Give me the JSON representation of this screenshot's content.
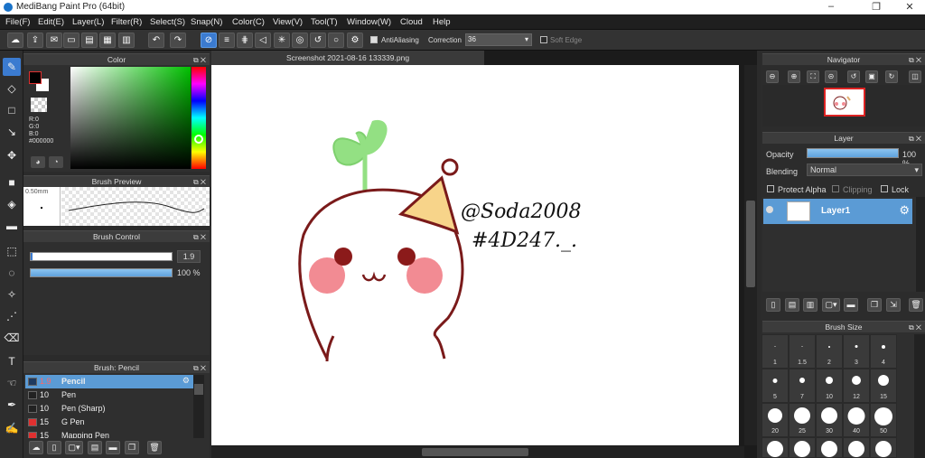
{
  "window": {
    "title": "MediBang Paint Pro (64bit)",
    "minimize": "–",
    "maximize": "❐",
    "close": "✕"
  },
  "menu": [
    "File(F)",
    "Edit(E)",
    "Layer(L)",
    "Filter(R)",
    "Select(S)",
    "Snap(N)",
    "Color(C)",
    "View(V)",
    "Tool(T)",
    "Window(W)",
    "Cloud",
    "Help"
  ],
  "toolbar": {
    "antialiasing_label": "AntiAliasing",
    "correction_label": "Correction",
    "correction_value": "36",
    "soft_edge_label": "Soft Edge"
  },
  "color_panel": {
    "title": "Color",
    "r": "R:0",
    "g": "G:0",
    "b": "B:0",
    "hex": "#000000",
    "primary_color": "#000000",
    "secondary_color": "#ffffff"
  },
  "brush_preview": {
    "title": "Brush Preview",
    "size": "0.50mm"
  },
  "brush_control": {
    "title": "Brush Control",
    "size_value": "1.9",
    "opacity_value": "100 %"
  },
  "brush_list": {
    "title": "Brush: Pencil",
    "items": [
      {
        "size": "1.9",
        "name": "Pencil",
        "color": "#1e3a5f",
        "selected": true
      },
      {
        "size": "10",
        "name": "Pen",
        "color": "#222222",
        "selected": false
      },
      {
        "size": "10",
        "name": "Pen (Sharp)",
        "color": "#222222",
        "selected": false
      },
      {
        "size": "15",
        "name": "G Pen",
        "color": "#e03030",
        "selected": false
      },
      {
        "size": "15",
        "name": "Mapping Pen",
        "color": "#e03030",
        "selected": false
      }
    ]
  },
  "document": {
    "tab_title": "Screenshot 2021-08-16 133339.png",
    "handwriting_line1": "@Soda2008",
    "handwriting_line2": "#4D247._."
  },
  "navigator": {
    "title": "Navigator"
  },
  "layer_panel": {
    "title": "Layer",
    "opacity_label": "Opacity",
    "opacity_value": "100 %",
    "opacity_fraction": 1.0,
    "blending_label": "Blending",
    "blending_value": "Normal",
    "protect_alpha_label": "Protect Alpha",
    "clipping_label": "Clipping",
    "lock_label": "Lock",
    "layer_name": "Layer1"
  },
  "brush_size": {
    "title": "Brush Size",
    "row1": [
      "1",
      "1.5",
      "2",
      "3",
      "4"
    ],
    "row2": [
      "5",
      "7",
      "10",
      "12",
      "15"
    ],
    "row3": [
      "20",
      "25",
      "30",
      "40",
      "50"
    ]
  }
}
